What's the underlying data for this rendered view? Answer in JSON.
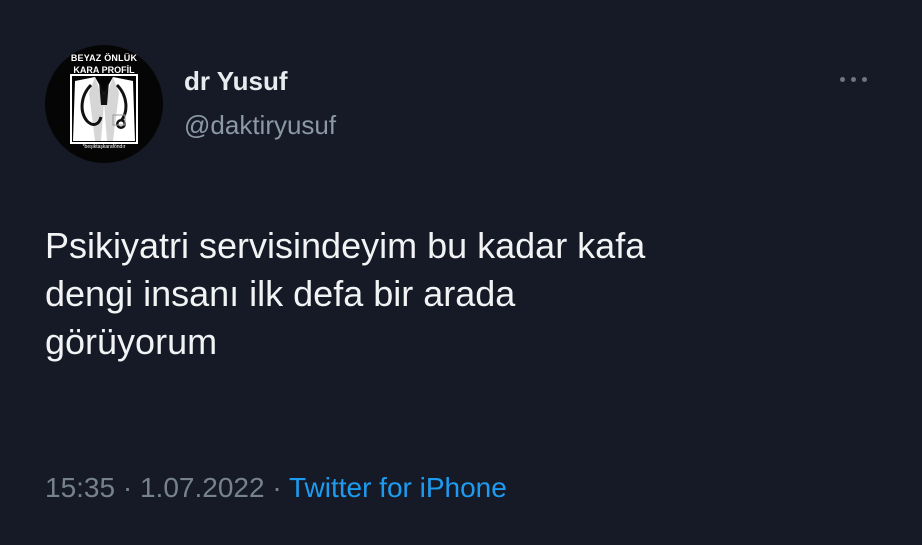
{
  "avatar": {
    "caption_top": "BEYAZ ÖNLÜK",
    "caption_mid": "KARA PROFİL",
    "caption_bottom": "*beşiktaşkaraföndır",
    "icon": "doctor-coat-stethoscope-icon"
  },
  "author": {
    "display_name": "dr Yusuf",
    "handle": "@daktiryusuf"
  },
  "more": {
    "icon": "more-horizontal-icon"
  },
  "tweet": {
    "lines": [
      "Psikiyatri servisindeyim bu kadar kafa",
      "dengi insanı ilk defa bir arada",
      "görüyorum"
    ]
  },
  "meta": {
    "time": "15:35",
    "separator": "·",
    "date": "1.07.2022",
    "source": "Twitter for iPhone"
  },
  "colors": {
    "background": "#161a26",
    "text": "#f2f3f5",
    "secondary": "#8b98a5",
    "link": "#1d9bf0"
  }
}
